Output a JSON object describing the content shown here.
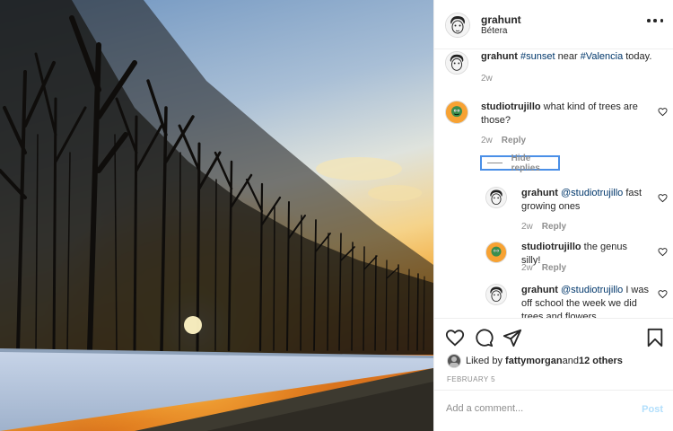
{
  "post": {
    "username": "grahunt",
    "location": "Bétera",
    "avatar_icon": "sketch-face-avatar-icon",
    "menu_icon": "more-options-icon"
  },
  "caption": {
    "user": "grahunt",
    "hashtag1": "#sunset",
    "text1": " near ",
    "hashtag2": "#Valencia",
    "text2": " today.",
    "time": "2w"
  },
  "comments": [
    {
      "user": "studiotrujillo",
      "text": " what kind of trees are those?",
      "time": "2w",
      "reply": "Reply"
    },
    {
      "user": "grahunt",
      "mention": "@studiotrujillo",
      "text": " fast growing ones",
      "time": "2w",
      "reply": "Reply"
    },
    {
      "user": "studiotrujillo",
      "text": " the genus silly!",
      "time": "2w",
      "reply": "Reply"
    },
    {
      "user": "grahunt",
      "mention": "@studiotrujillo",
      "text": " I was off school the week we did trees and flowers"
    }
  ],
  "hide_replies": "Hide replies",
  "likes": {
    "prefix": "Liked by ",
    "user": "fattymorgan",
    "mid": " and ",
    "others": "12 others"
  },
  "date": "FEBRUARY 5",
  "comment_box": {
    "placeholder": "Add a comment...",
    "post_label": "Post"
  },
  "colors": {
    "link": "#00376b",
    "muted": "#8e8e8e",
    "post_disabled": "#b2dffc",
    "focus": "#4a8fe7"
  }
}
